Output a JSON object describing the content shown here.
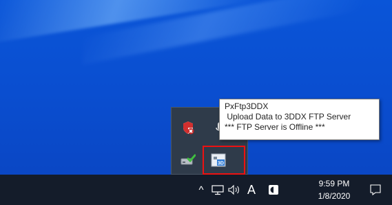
{
  "tooltip": {
    "title": "PxFtp3DDX",
    "line1": " Upload Data to 3DDX FTP Server",
    "line2": "*** FTP Server is Offline ***"
  },
  "tray_icons": {
    "security_icon": "shield-x-icon",
    "hidden_icon": "microphone-icon",
    "network_icon": "drive-check-icon",
    "app_icon": "3d-ftp-app-icon",
    "app_icon_text": "3D"
  },
  "taskbar": {
    "show_hidden_glyph": "^",
    "input_indicator": "A",
    "clock_time": "9:59 PM",
    "clock_date": "1/8/2020"
  },
  "colors": {
    "desktop": "#0a55d8",
    "taskbar": "#141c2a",
    "highlight": "#ee1111"
  }
}
